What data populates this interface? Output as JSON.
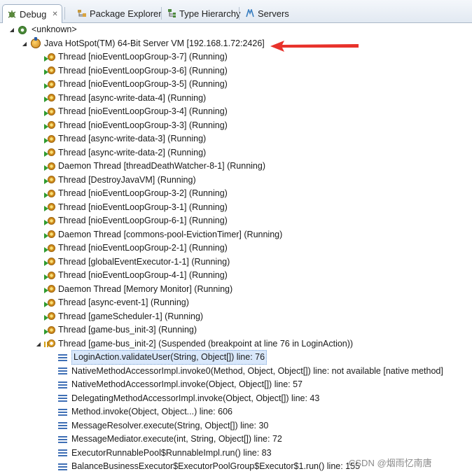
{
  "tabs": [
    {
      "label": "Debug",
      "close": "✕",
      "icon": "debug-icon"
    },
    {
      "label": "Package Explorer",
      "icon": "package-explorer-icon"
    },
    {
      "label": "Type Hierarchy",
      "icon": "type-hierarchy-icon"
    },
    {
      "label": "Servers",
      "icon": "servers-icon"
    }
  ],
  "tree": {
    "root": "<unknown>",
    "vm": "Java HotSpot(TM) 64-Bit Server VM [192.168.1.72:2426]",
    "threads": [
      "Thread [nioEventLoopGroup-3-7] (Running)",
      "Thread [nioEventLoopGroup-3-6] (Running)",
      "Thread [nioEventLoopGroup-3-5] (Running)",
      "Thread [async-write-data-4] (Running)",
      "Thread [nioEventLoopGroup-3-4] (Running)",
      "Thread [nioEventLoopGroup-3-3] (Running)",
      "Thread [async-write-data-3] (Running)",
      "Thread [async-write-data-2] (Running)",
      "Daemon Thread [threadDeathWatcher-8-1] (Running)",
      "Thread [DestroyJavaVM] (Running)",
      "Thread [nioEventLoopGroup-3-2] (Running)",
      "Thread [nioEventLoopGroup-3-1] (Running)",
      "Thread [nioEventLoopGroup-6-1] (Running)",
      "Daemon Thread [commons-pool-EvictionTimer] (Running)",
      "Thread [nioEventLoopGroup-2-1] (Running)",
      "Thread [globalEventExecutor-1-1] (Running)",
      "Thread [nioEventLoopGroup-4-1] (Running)",
      "Daemon Thread [Memory Monitor] (Running)",
      "Thread [async-event-1] (Running)",
      "Thread [gameScheduler-1] (Running)",
      "Thread [game-bus_init-3] (Running)"
    ],
    "suspended_thread": "Thread [game-bus_init-2] (Suspended (breakpoint at line 76 in LoginAction))",
    "frames": [
      "LoginAction.validateUser(String, Object[]) line: 76",
      "NativeMethodAccessorImpl.invoke0(Method, Object, Object[]) line: not available [native method]",
      "NativeMethodAccessorImpl.invoke(Object, Object[]) line: 57",
      "DelegatingMethodAccessorImpl.invoke(Object, Object[]) line: 43",
      "Method.invoke(Object, Object...) line: 606",
      "MessageResolver.execute(String, Object[]) line: 30",
      "MessageMediator.execute(int, String, Object[]) line: 72",
      "ExecutorRunnablePool$RunnableImpl.run() line: 83",
      "BalanceBusinessExecutor$ExecutorPoolGroup$Executor$1.run() line: 155"
    ]
  },
  "watermark": "CSDN @烟雨忆南唐",
  "colors": {
    "arrow": "#e8322b",
    "selection": "#d9e8fb"
  }
}
